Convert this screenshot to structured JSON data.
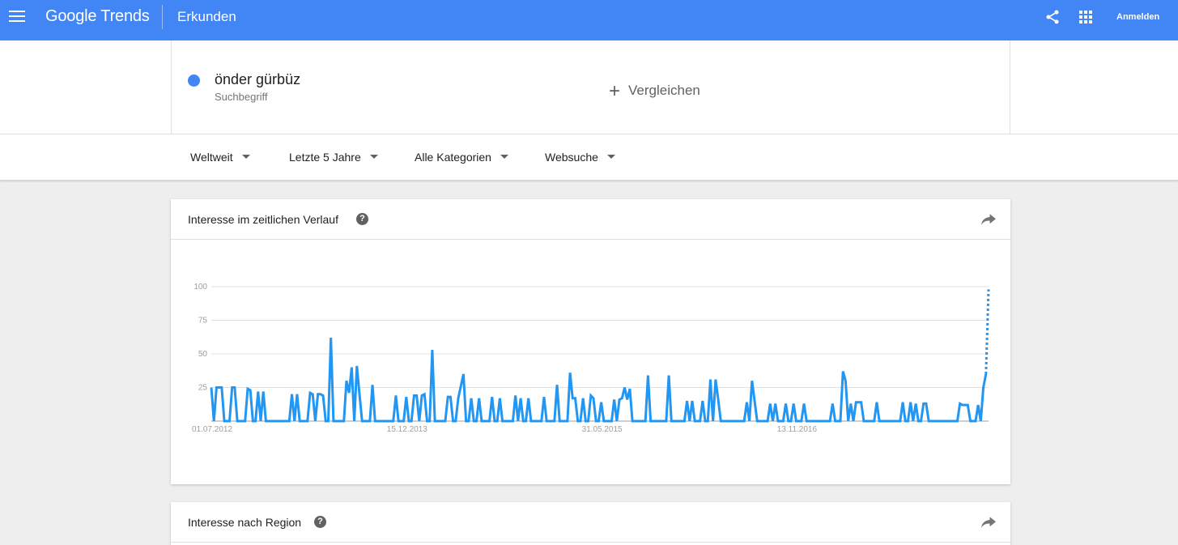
{
  "header": {
    "logo_google": "Google",
    "logo_trends": "Trends",
    "section": "Erkunden",
    "signin": "Anmelden",
    "brand_color": "#4285f4",
    "icons": [
      "menu-icon",
      "share-icon",
      "apps-icon"
    ]
  },
  "search": {
    "term": "önder gürbüz",
    "term_type": "Suchbegriff",
    "term_color": "#4285f4",
    "compare_icon": "+",
    "compare_label": "Vergleichen"
  },
  "filters": [
    {
      "label": "Weltweit"
    },
    {
      "label": "Letzte 5 Jahre"
    },
    {
      "label": "Alle Kategorien"
    },
    {
      "label": "Websuche"
    }
  ],
  "cards": {
    "timeline": {
      "title": "Interesse im zeitlichen Verlauf",
      "help": "?"
    },
    "region": {
      "title": "Interesse nach Region",
      "help": "?"
    }
  },
  "chart_data": {
    "type": "line",
    "title": "",
    "xlabel": "",
    "ylabel": "",
    "ylim": [
      0,
      100
    ],
    "yticks": [
      100,
      75,
      50,
      25
    ],
    "xticks": [
      "01.07.2012",
      "15.12.2013",
      "31.05.2015",
      "13.11.2016"
    ],
    "grid": true,
    "line_color": "#2196f3",
    "partial_last_segment": "dotted",
    "series": [
      {
        "values": [
          25,
          0,
          25,
          25,
          25,
          0,
          0,
          0,
          25,
          25,
          0,
          0,
          0,
          0,
          24,
          23,
          0,
          0,
          22,
          0,
          22,
          0,
          0,
          0,
          0,
          0,
          0,
          0,
          0,
          0,
          0,
          20,
          0,
          20,
          0,
          0,
          0,
          0,
          21,
          20,
          0,
          20,
          20,
          19,
          0,
          0,
          62,
          0,
          0,
          0,
          0,
          0,
          30,
          21,
          40,
          0,
          41,
          20,
          0,
          0,
          0,
          0,
          27,
          0,
          0,
          0,
          0,
          0,
          0,
          0,
          0,
          19,
          0,
          0,
          0,
          18,
          0,
          0,
          19,
          19,
          0,
          19,
          20,
          0,
          0,
          53,
          0,
          0,
          0,
          0,
          0,
          18,
          18,
          0,
          0,
          17,
          26,
          35,
          0,
          0,
          17,
          0,
          0,
          17,
          0,
          0,
          0,
          0,
          18,
          0,
          0,
          17,
          0,
          0,
          0,
          0,
          0,
          19,
          0,
          17,
          0,
          0,
          17,
          0,
          0,
          0,
          0,
          0,
          18,
          0,
          0,
          0,
          0,
          27,
          0,
          0,
          0,
          0,
          36,
          17,
          17,
          0,
          0,
          17,
          0,
          0,
          19,
          17,
          0,
          0,
          14,
          0,
          0,
          0,
          0,
          16,
          0,
          16,
          17,
          25,
          16,
          24,
          0,
          0,
          0,
          0,
          0,
          0,
          34,
          0,
          0,
          0,
          0,
          0,
          0,
          0,
          34,
          0,
          0,
          0,
          0,
          0,
          0,
          15,
          0,
          15,
          0,
          0,
          0,
          15,
          0,
          0,
          31,
          0,
          31,
          16,
          0,
          0,
          0,
          0,
          0,
          0,
          0,
          0,
          0,
          0,
          14,
          0,
          30,
          15,
          0,
          0,
          0,
          0,
          0,
          13,
          0,
          13,
          0,
          0,
          0,
          13,
          0,
          0,
          13,
          0,
          0,
          0,
          13,
          0,
          0,
          0,
          0,
          0,
          0,
          0,
          0,
          0,
          0,
          13,
          0,
          0,
          0,
          37,
          30,
          0,
          13,
          0,
          14,
          14,
          14,
          0,
          0,
          0,
          0,
          0,
          14,
          0,
          0,
          0,
          0,
          0,
          0,
          0,
          0,
          0,
          14,
          0,
          0,
          14,
          0,
          13,
          0,
          0,
          13,
          13,
          0,
          0,
          0,
          0,
          0,
          0,
          0,
          0,
          0,
          0,
          0,
          0,
          13,
          12,
          12,
          12,
          0,
          0,
          0,
          12,
          0,
          25,
          35,
          98
        ]
      }
    ]
  }
}
